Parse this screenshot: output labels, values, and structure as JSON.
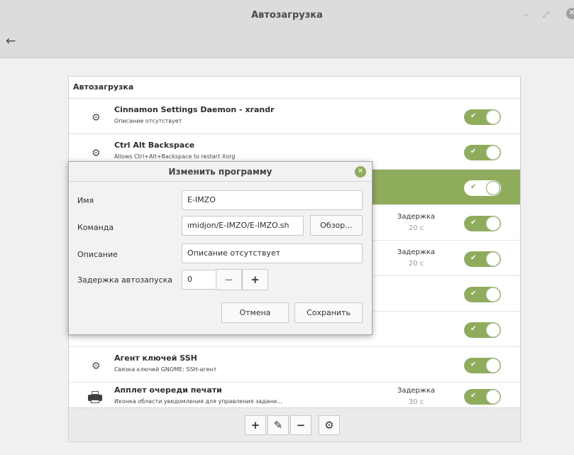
{
  "window": {
    "title": "Автозагрузка",
    "minimize_glyph": "–",
    "maximize_glyph": "⤢",
    "close_glyph": "✕",
    "back_glyph": "←"
  },
  "panel": {
    "header": "Автозагрузка",
    "rows": [
      {
        "name": "Cinnamon Settings Daemon - xrandr",
        "desc": "Описание отсутствует",
        "icon": "gear-icon",
        "enabled": true
      },
      {
        "name": "Ctrl Alt Backspace",
        "desc": "Allows Ctrl+Alt+Backspace to restart Xorg",
        "icon": "gear-icon",
        "enabled": true
      },
      {
        "name": "",
        "desc": "",
        "icon": "",
        "enabled": true,
        "selected": true
      },
      {
        "name": "",
        "desc": "",
        "delay_label": "Задержка",
        "delay_value": "20 с",
        "enabled": true
      },
      {
        "name": "",
        "desc": "",
        "delay_label": "Задержка",
        "delay_value": "20 с",
        "enabled": true
      },
      {
        "name": "",
        "desc": "",
        "enabled": true
      },
      {
        "name": "",
        "desc": "",
        "enabled": true
      },
      {
        "name": "Агент ключей SSH",
        "desc": "Связка ключей GNOME: SSH-агент",
        "icon": "gear-icon",
        "enabled": true
      },
      {
        "name": "Апплет очереди печати",
        "desc": "Иконка области уведомления для управления задани...",
        "icon": "printer-icon",
        "delay_label": "Задержка",
        "delay_value": "30 с",
        "enabled": true
      }
    ],
    "toggle_check": "✔"
  },
  "toolbar": {
    "add": "+",
    "edit": "✎",
    "remove": "−",
    "settings": "⚙"
  },
  "dialog": {
    "title": "Изменить программу",
    "close_glyph": "✕",
    "name_label": "Имя",
    "name_value": "E-IMZO",
    "command_label": "Команда",
    "command_value": "ımidjon/E-IMZO/E-IMZO.sh",
    "browse_label": "Обзор...",
    "description_label": "Описание",
    "description_value": "Описание отсутствует",
    "delay_label": "Задержка автозапуска",
    "delay_value": "0",
    "decrement": "−",
    "increment": "+",
    "cancel_label": "Отмена",
    "save_label": "Сохранить"
  }
}
